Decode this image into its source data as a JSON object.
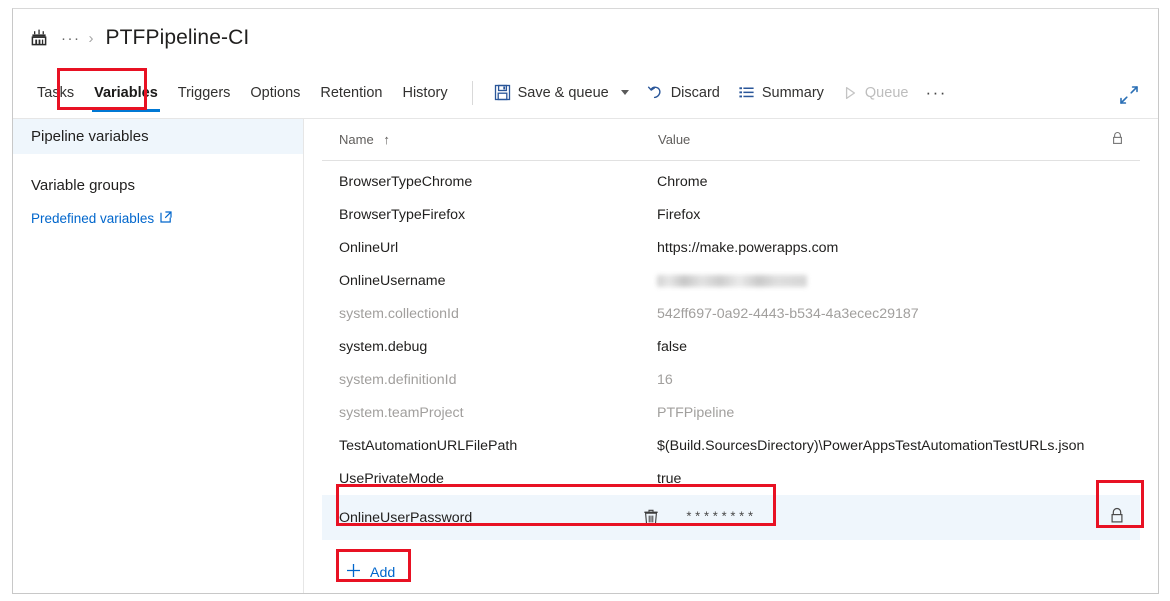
{
  "breadcrumb": {
    "build_icon": "build-pipeline-icon",
    "ellipsis": "···",
    "separator": "›",
    "title": "PTFPipeline-CI"
  },
  "tabs": [
    {
      "label": "Tasks",
      "active": false
    },
    {
      "label": "Variables",
      "active": true
    },
    {
      "label": "Triggers",
      "active": false
    },
    {
      "label": "Options",
      "active": false
    },
    {
      "label": "Retention",
      "active": false
    },
    {
      "label": "History",
      "active": false
    }
  ],
  "toolbar": {
    "save_queue_label": "Save & queue",
    "save_icon": "save-disk-icon",
    "discard_label": "Discard",
    "discard_icon": "undo-arrow-icon",
    "summary_label": "Summary",
    "summary_icon": "list-lines-icon",
    "queue_label": "Queue",
    "queue_icon": "play-triangle-icon",
    "overflow_label": "···",
    "expand_icon": "expand-diagonal-icon"
  },
  "sidebar": {
    "items": [
      {
        "label": "Pipeline variables",
        "selected": true
      },
      {
        "label": "Variable groups",
        "selected": false
      }
    ],
    "link": {
      "label": "Predefined variables",
      "icon": "external-link-icon"
    }
  },
  "grid": {
    "columns": {
      "name": "Name",
      "sort_glyph": "↑",
      "value": "Value",
      "lock": "lock-icon"
    },
    "rows": [
      {
        "name": "BrowserTypeChrome",
        "value": "Chrome",
        "muted": false,
        "selected": false,
        "secret": false,
        "blurred": false,
        "lock": false
      },
      {
        "name": "BrowserTypeFirefox",
        "value": "Firefox",
        "muted": false,
        "selected": false,
        "secret": false,
        "blurred": false,
        "lock": false
      },
      {
        "name": "OnlineUrl",
        "value": "https://make.powerapps.com",
        "muted": false,
        "selected": false,
        "secret": false,
        "blurred": false,
        "lock": false
      },
      {
        "name": "OnlineUsername",
        "value": "",
        "muted": false,
        "selected": false,
        "secret": false,
        "blurred": true,
        "lock": false
      },
      {
        "name": "system.collectionId",
        "value": "542ff697-0a92-4443-b534-4a3ecec29187",
        "muted": true,
        "selected": false,
        "secret": false,
        "blurred": false,
        "lock": false
      },
      {
        "name": "system.debug",
        "value": "false",
        "muted": false,
        "selected": false,
        "secret": false,
        "blurred": false,
        "lock": false
      },
      {
        "name": "system.definitionId",
        "value": "16",
        "muted": true,
        "selected": false,
        "secret": false,
        "blurred": false,
        "lock": false
      },
      {
        "name": "system.teamProject",
        "value": "PTFPipeline",
        "muted": true,
        "selected": false,
        "secret": false,
        "blurred": false,
        "lock": false
      },
      {
        "name": "TestAutomationURLFilePath",
        "value": "$(Build.SourcesDirectory)\\PowerAppsTestAutomationTestURLs.json",
        "muted": false,
        "selected": false,
        "secret": false,
        "blurred": false,
        "lock": false
      },
      {
        "name": "UsePrivateMode",
        "value": "true",
        "muted": false,
        "selected": false,
        "secret": false,
        "blurred": false,
        "lock": false
      },
      {
        "name": "OnlineUserPassword",
        "value": "********",
        "muted": false,
        "selected": true,
        "secret": true,
        "blurred": false,
        "lock": true
      }
    ],
    "add_label": "Add",
    "add_icon": "plus-icon",
    "delete_icon": "trash-icon",
    "locked_icon": "padlock-closed-icon"
  },
  "annotations": {
    "color": "#e81123",
    "boxes": [
      {
        "name": "highlight-variables-tab"
      },
      {
        "name": "highlight-password-row"
      },
      {
        "name": "highlight-lock-toggle"
      },
      {
        "name": "highlight-add-button"
      }
    ]
  }
}
